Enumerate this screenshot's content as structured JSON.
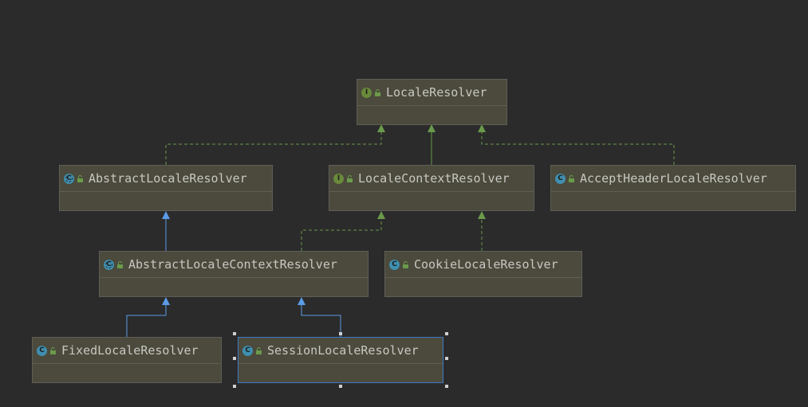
{
  "colors": {
    "background": "#2b2b2b",
    "node_fill": "#4b4a3c",
    "implements_edge": "#6a9a4a",
    "extends_edge": "#5b9be6",
    "selection": "#3d7ac7"
  },
  "nodes": {
    "locale_resolver": {
      "label": "LocaleResolver",
      "kind": "interface",
      "kind_letter": "I",
      "icon": "interface-icon"
    },
    "abstract_locale_resolver": {
      "label": "AbstractLocaleResolver",
      "kind": "abstract class",
      "kind_letter": "C",
      "icon": "abstract-class-icon"
    },
    "locale_context_resolver": {
      "label": "LocaleContextResolver",
      "kind": "interface",
      "kind_letter": "I",
      "icon": "interface-icon"
    },
    "accept_header_locale_resolver": {
      "label": "AcceptHeaderLocaleResolver",
      "kind": "class",
      "kind_letter": "C",
      "icon": "class-icon"
    },
    "abstract_locale_context_resolver": {
      "label": "AbstractLocaleContextResolver",
      "kind": "abstract class",
      "kind_letter": "C",
      "icon": "abstract-class-icon"
    },
    "cookie_locale_resolver": {
      "label": "CookieLocaleResolver",
      "kind": "class",
      "kind_letter": "C",
      "icon": "class-icon"
    },
    "fixed_locale_resolver": {
      "label": "FixedLocaleResolver",
      "kind": "class",
      "kind_letter": "C",
      "icon": "class-icon"
    },
    "session_locale_resolver": {
      "label": "SessionLocaleResolver",
      "kind": "class",
      "kind_letter": "C",
      "icon": "class-icon",
      "selected": true
    }
  },
  "relations": [
    {
      "from": "AbstractLocaleResolver",
      "to": "LocaleResolver",
      "type": "implements"
    },
    {
      "from": "LocaleContextResolver",
      "to": "LocaleResolver",
      "type": "extends"
    },
    {
      "from": "AcceptHeaderLocaleResolver",
      "to": "LocaleResolver",
      "type": "implements"
    },
    {
      "from": "AbstractLocaleContextResolver",
      "to": "AbstractLocaleResolver",
      "type": "extends"
    },
    {
      "from": "AbstractLocaleContextResolver",
      "to": "LocaleContextResolver",
      "type": "implements"
    },
    {
      "from": "CookieLocaleResolver",
      "to": "LocaleContextResolver",
      "type": "implements"
    },
    {
      "from": "FixedLocaleResolver",
      "to": "AbstractLocaleContextResolver",
      "type": "extends"
    },
    {
      "from": "SessionLocaleResolver",
      "to": "AbstractLocaleContextResolver",
      "type": "extends"
    }
  ]
}
